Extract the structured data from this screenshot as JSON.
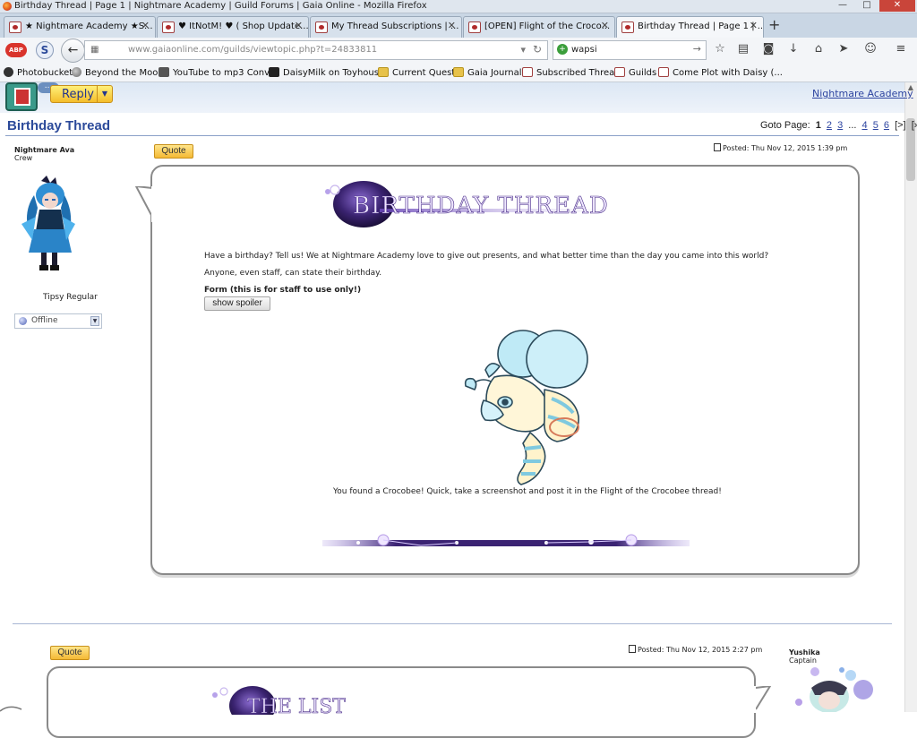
{
  "window": {
    "title": "Birthday Thread | Page 1 | Nightmare Academy | Guild Forums | Gaia Online - Mozilla Firefox",
    "buttons": {
      "minimize": "—",
      "maximize": "□",
      "close": "✕"
    }
  },
  "tabs": [
    {
      "label": "★ Nightmare Academy ★S...",
      "active": false
    },
    {
      "label": "♥ ItNotM! ♥ ( Shop Update...",
      "active": false
    },
    {
      "label": "My Thread Subscriptions | ...",
      "active": false
    },
    {
      "label": "[OPEN] Flight of the Croco...",
      "active": false
    },
    {
      "label": "Birthday Thread | Page 1 | ...",
      "active": true
    }
  ],
  "navbar": {
    "url": "www.gaiaonline.com/guilds/viewtopic.php?t=24833811",
    "search_value": "wapsi"
  },
  "bookmarks": [
    {
      "label": "Photobucket",
      "icon": "photo"
    },
    {
      "label": "Beyond the Moon",
      "icon": "globe"
    },
    {
      "label": "YouTube to mp3 Conv...",
      "icon": "yt"
    },
    {
      "label": "DaisyMilk on Toyhouse",
      "icon": "dm"
    },
    {
      "label": "Current Quests",
      "icon": "folder"
    },
    {
      "label": "Gaia Journals",
      "icon": "folder"
    },
    {
      "label": "Subscribed Threads",
      "icon": "gaia"
    },
    {
      "label": "Guilds",
      "icon": "gaia"
    },
    {
      "label": "Come Plot with Daisy (...",
      "icon": "gaia"
    }
  ],
  "guild": {
    "reply_label": "Reply",
    "bubble": "...",
    "guild_link": "Nightmare Academy"
  },
  "thread": {
    "title": "Birthday Thread",
    "goto_label": "Goto Page:",
    "pages": {
      "current": "1",
      "links": [
        "2",
        "3"
      ],
      "ellipsis": "...",
      "tail_links": [
        "4",
        "5",
        "6"
      ],
      "next": "[>]",
      "last": "[»|]"
    }
  },
  "post1": {
    "username": "Nightmare Ava",
    "rank": "Crew",
    "user_title": "Tipsy Regular",
    "status": "Offline",
    "quote_label": "Quote",
    "posted": "Posted: Thu Nov 12, 2015 1:39 pm",
    "banner_text": "BIRTHDAY THREAD",
    "paragraph1": "Have a birthday? Tell us! We at Nightmare Academy love to give out presents, and what better time than the day you came into this world?",
    "paragraph2": "Anyone, even staff, can state their birthday.",
    "form_label": "Form (this is for staff to use only!)",
    "spoiler_label": "show spoiler",
    "crocobee_text": "You found a Crocobee! Quick, take a screenshot and post it in the Flight of the Crocobee thread!"
  },
  "post2": {
    "username": "Yushika",
    "rank": "Captain",
    "quote_label": "Quote",
    "posted": "Posted: Thu Nov 12, 2015 2:27 pm",
    "banner_text": "THE LIST"
  },
  "colors": {
    "accent": "#2c4a9a",
    "quote_button": "#f4b935",
    "banner_purple": "#5a3a9a"
  }
}
